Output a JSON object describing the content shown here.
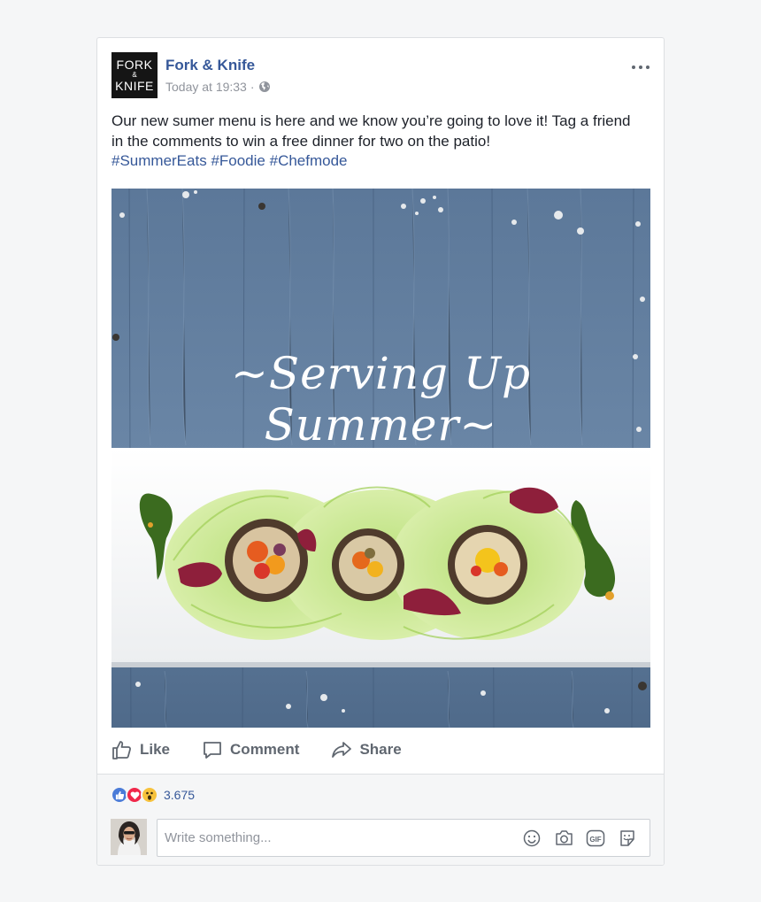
{
  "page": {
    "name": "Fork & Knife",
    "logo_line1": "FORK",
    "logo_amp": "&",
    "logo_line2": "KNIFE",
    "timestamp": "Today at 19:33",
    "separator": "·"
  },
  "post": {
    "text": "Our new sumer menu is here and we know you’re going to love it! Tag a friend in the comments to win a free dinner for two on the patio!",
    "hashtags": [
      "#SummerEats",
      "#Foodie",
      "#Chefmode"
    ],
    "image_title": "~Serving Up Summer~"
  },
  "actions": {
    "like": "Like",
    "comment": "Comment",
    "share": "Share"
  },
  "reactions": {
    "types": [
      "like",
      "love",
      "wow"
    ],
    "count": "3.675"
  },
  "comment_box": {
    "placeholder": "Write something...",
    "icons": [
      "emoji-icon",
      "camera-icon",
      "gif-icon",
      "sticker-icon"
    ]
  },
  "colors": {
    "link": "#365899",
    "text": "#1d2129",
    "muted": "#90949c",
    "like_blue": "#4a7bd8",
    "love_red": "#f0284a",
    "wow_yellow": "#f7c23c"
  }
}
